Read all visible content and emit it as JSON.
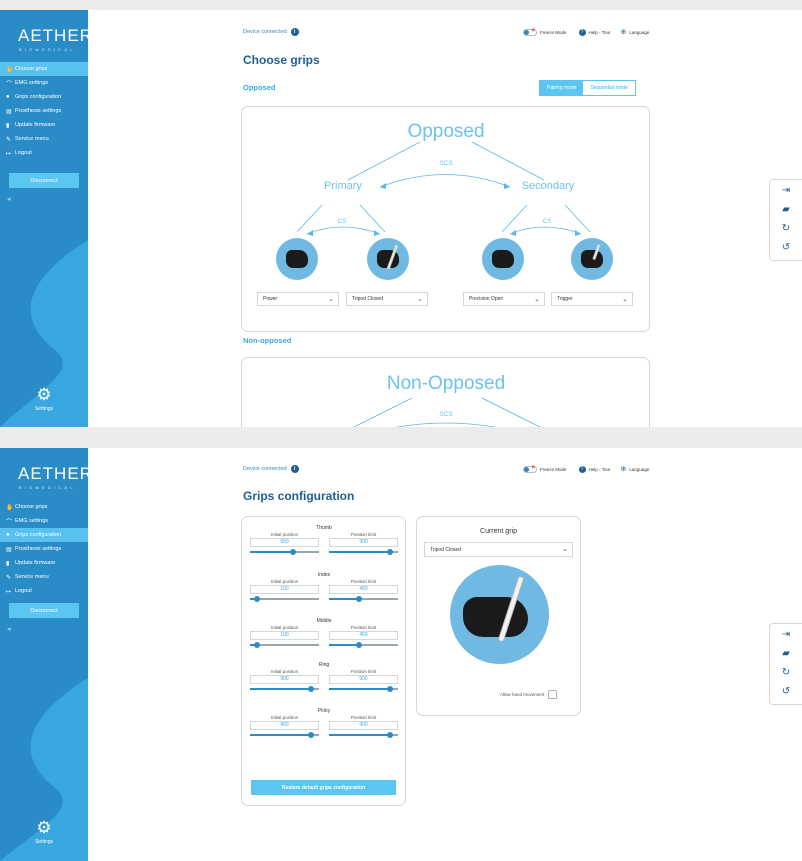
{
  "brand": {
    "logo": "AETHER",
    "subtitle": "BIOMEDICAL"
  },
  "nav": [
    {
      "icon": "hand-icon",
      "glyph": "✋",
      "label": "Choose grips"
    },
    {
      "icon": "chart-icon",
      "glyph": "⌒",
      "label": "EMG settings"
    },
    {
      "icon": "grip-icon",
      "glyph": "●",
      "label": "Grips configuration"
    },
    {
      "icon": "document-icon",
      "glyph": "▤",
      "label": "Prosthesis settings"
    },
    {
      "icon": "firmware-icon",
      "glyph": "▮",
      "label": "Update firmware"
    },
    {
      "icon": "wrench-icon",
      "glyph": "✎",
      "label": "Service menu"
    },
    {
      "icon": "logout-icon",
      "glyph": "↦",
      "label": "Logout"
    }
  ],
  "sidebar": {
    "disconnect": "Disconnect",
    "collapse": "◂",
    "settings": "Settings"
  },
  "topbar": {
    "device": "Device connected",
    "freeze": "Freeze Mode",
    "help": "Help - Tour",
    "language": "Language"
  },
  "screen1": {
    "title": "Choose grips",
    "opposed_heading": "Opposed",
    "modes": [
      "Pairing mode",
      "Sequential mode"
    ],
    "diagram": {
      "title": "Opposed",
      "primary": "Primary",
      "secondary": "Secondary",
      "scs": "SCS",
      "cs_left": "CS",
      "cs_right": "CS"
    },
    "grips": [
      {
        "name": "Power",
        "image": "power-grip"
      },
      {
        "name": "Tripod Closed",
        "image": "tripod-closed-grip"
      },
      {
        "name": "Precision Open",
        "image": "precision-open-grip"
      },
      {
        "name": "Trigger",
        "image": "trigger-grip"
      }
    ],
    "non_opposed_heading": "Non-opposed",
    "non_opposed_diagram": {
      "title": "Non-Opposed",
      "scs": "SCS"
    }
  },
  "screen2": {
    "title": "Grips configuration",
    "col_initial": "Initial position",
    "col_limit": "Position limit",
    "fingers": [
      {
        "name": "Thumb",
        "initial": "650",
        "limit": "900",
        "initial_frac": 0.62,
        "limit_frac": 0.88
      },
      {
        "name": "Index",
        "initial": "100",
        "limit": "450",
        "initial_frac": 0.1,
        "limit_frac": 0.44
      },
      {
        "name": "Middle",
        "initial": "100",
        "limit": "450",
        "initial_frac": 0.1,
        "limit_frac": 0.44
      },
      {
        "name": "Ring",
        "initial": "900",
        "limit": "900",
        "initial_frac": 0.88,
        "limit_frac": 0.88
      },
      {
        "name": "Pinky",
        "initial": "900",
        "limit": "900",
        "initial_frac": 0.88,
        "limit_frac": 0.88
      }
    ],
    "restore": "Restore default grips configuration",
    "current_grip_title": "Current grip",
    "current_grip": "Tripod Closed",
    "allow_movement": "Allow hand movement"
  },
  "toolbar": [
    "login-icon",
    "folder-icon",
    "replay-icon",
    "undo-icon"
  ],
  "colors": {
    "sidebar": "#2a8cc7",
    "accent": "#5cc6f2",
    "navy": "#1f5f93"
  }
}
